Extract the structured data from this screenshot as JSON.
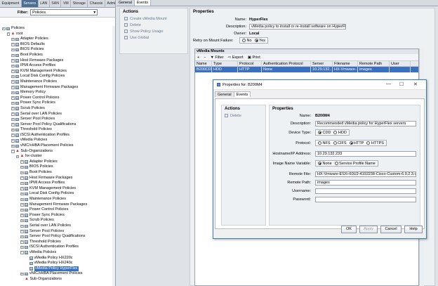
{
  "nav_tabs": [
    "Equipment",
    "Servers",
    "LAN",
    "SAN",
    "VM",
    "Storage",
    "Chassis",
    "Admin"
  ],
  "filter": {
    "label": "Filter:",
    "value": "Policies"
  },
  "tree": [
    {
      "t": "Policies",
      "d": 0,
      "ex": "-",
      "k": "folder"
    },
    {
      "t": "root",
      "d": 1,
      "ex": "-",
      "k": "org"
    },
    {
      "t": "Adapter Policies",
      "d": 2,
      "ex": "+",
      "k": "folder"
    },
    {
      "t": "BIOS Defaults",
      "d": 2,
      "ex": "+",
      "k": "folder"
    },
    {
      "t": "BIOS Policies",
      "d": 2,
      "ex": "+",
      "k": "folder"
    },
    {
      "t": "Boot Policies",
      "d": 2,
      "ex": "+",
      "k": "folder"
    },
    {
      "t": "Host Firmware Packages",
      "d": 2,
      "ex": "+",
      "k": "folder"
    },
    {
      "t": "IPMI Access Profiles",
      "d": 2,
      "ex": "+",
      "k": "folder"
    },
    {
      "t": "KVM Management Policies",
      "d": 2,
      "ex": "+",
      "k": "folder"
    },
    {
      "t": "Local Disk Config Policies",
      "d": 2,
      "ex": "+",
      "k": "folder"
    },
    {
      "t": "Maintenance Policies",
      "d": 2,
      "ex": "+",
      "k": "folder"
    },
    {
      "t": "Management Firmware Packages",
      "d": 2,
      "ex": "+",
      "k": "folder"
    },
    {
      "t": "Memory Policy",
      "d": 2,
      "ex": "+",
      "k": "folder"
    },
    {
      "t": "Power Control Policies",
      "d": 2,
      "ex": "+",
      "k": "folder"
    },
    {
      "t": "Power Sync Policies",
      "d": 2,
      "ex": "+",
      "k": "folder"
    },
    {
      "t": "Scrub Policies",
      "d": 2,
      "ex": "+",
      "k": "folder"
    },
    {
      "t": "Serial over LAN Policies",
      "d": 2,
      "ex": "+",
      "k": "folder"
    },
    {
      "t": "Server Pool Policies",
      "d": 2,
      "ex": "+",
      "k": "folder"
    },
    {
      "t": "Server Pool Policy Qualifications",
      "d": 2,
      "ex": "+",
      "k": "folder"
    },
    {
      "t": "Threshold Policies",
      "d": 2,
      "ex": "+",
      "k": "folder"
    },
    {
      "t": "iSCSI Authentication Profiles",
      "d": 2,
      "ex": "+",
      "k": "folder"
    },
    {
      "t": "vMedia Policies",
      "d": 2,
      "ex": "+",
      "k": "folder"
    },
    {
      "t": "vNIC/vHBA Placement Policies",
      "d": 2,
      "ex": "+",
      "k": "folder"
    },
    {
      "t": "Sub-Organizations",
      "d": 2,
      "ex": "-",
      "k": "org"
    },
    {
      "t": "hx-cluster",
      "d": 3,
      "ex": "-",
      "k": "org"
    },
    {
      "t": "Adapter Policies",
      "d": 4,
      "ex": "+",
      "k": "folder"
    },
    {
      "t": "BIOS Policies",
      "d": 4,
      "ex": "+",
      "k": "folder"
    },
    {
      "t": "Boot Policies",
      "d": 4,
      "ex": "+",
      "k": "folder"
    },
    {
      "t": "Host Firmware Packages",
      "d": 4,
      "ex": "+",
      "k": "folder"
    },
    {
      "t": "IPMI Access Profiles",
      "d": 4,
      "ex": "+",
      "k": "folder"
    },
    {
      "t": "KVM Management Policies",
      "d": 4,
      "ex": "+",
      "k": "folder"
    },
    {
      "t": "Local Disk Config Policies",
      "d": 4,
      "ex": "+",
      "k": "folder"
    },
    {
      "t": "Maintenance Policies",
      "d": 4,
      "ex": "+",
      "k": "folder"
    },
    {
      "t": "Management Firmware Packages",
      "d": 4,
      "ex": "+",
      "k": "folder"
    },
    {
      "t": "Power Control Policies",
      "d": 4,
      "ex": "+",
      "k": "folder"
    },
    {
      "t": "Power Sync Policies",
      "d": 4,
      "ex": "+",
      "k": "folder"
    },
    {
      "t": "Scrub Policies",
      "d": 4,
      "ex": "+",
      "k": "folder"
    },
    {
      "t": "Serial over LAN Policies",
      "d": 4,
      "ex": "+",
      "k": "folder"
    },
    {
      "t": "Server Pool Policies",
      "d": 4,
      "ex": "+",
      "k": "folder"
    },
    {
      "t": "Server Pool Policy Qualifications",
      "d": 4,
      "ex": "+",
      "k": "folder"
    },
    {
      "t": "Threshold Policies",
      "d": 4,
      "ex": "+",
      "k": "folder"
    },
    {
      "t": "iSCSI Authentication Profiles",
      "d": 4,
      "ex": "+",
      "k": "folder"
    },
    {
      "t": "vMedia Policies",
      "d": 4,
      "ex": "-",
      "k": "folder"
    },
    {
      "t": "vMedia Policy HX220c",
      "d": 5,
      "ex": "",
      "k": "item"
    },
    {
      "t": "vMedia Policy HX240c",
      "d": 5,
      "ex": "",
      "k": "item"
    },
    {
      "t": "vMedia Policy HyperFlex",
      "d": 5,
      "ex": "",
      "k": "item",
      "selected": true
    },
    {
      "t": "vNIC/vHBA Placement Policies",
      "d": 4,
      "ex": "+",
      "k": "folder"
    },
    {
      "t": "Sub-Organizations",
      "d": 4,
      "ex": "",
      "k": "org"
    }
  ],
  "right_tabs": [
    "General",
    "Events"
  ],
  "actions": {
    "title": "Actions",
    "items": [
      "Create vMedia Mount",
      "Delete",
      "Show Policy Usage",
      "Use Global"
    ]
  },
  "properties": {
    "title": "Properties",
    "name_label": "Name:",
    "name": "HyperFlex",
    "desc_label": "Description:",
    "desc": "vMedia policy to install or re-install software on HyperFlex servers",
    "owner_label": "Owner:",
    "owner": "Local",
    "retry_label": "Retry on Mount Failure:",
    "retry_no": "No",
    "retry_yes": "Yes"
  },
  "mounts": {
    "title": "vMedia Mounts",
    "tools": [
      "Filter",
      "Export",
      "Print"
    ],
    "columns": [
      "Name",
      "Type",
      "Protocol",
      "Authentication Protocol",
      "Server",
      "Filename",
      "Remote Path",
      "User"
    ],
    "row": [
      "B200CDD",
      "HDD",
      "HTTP",
      "None",
      "10.29.132...",
      "HX-Vmware-...",
      "images",
      ""
    ]
  },
  "dialog": {
    "title": "Properties for: B200M4",
    "tabs": [
      "General",
      "Events"
    ],
    "actions_title": "Actions",
    "delete": "Delete",
    "props_title": "Properties",
    "name_label": "Name:",
    "name": "B200M4",
    "desc_label": "Description:",
    "desc": "Recommended vMedia policy for HyperFlex servers",
    "devtype_label": "Device Type:",
    "dev_cdd": "CDD",
    "dev_hdd": "HDD",
    "protocol_label": "Protocol:",
    "protocols": [
      "NFS",
      "CIFS",
      "HTTP",
      "HTTPS"
    ],
    "host_label": "Hostname/IP Address:",
    "host": "10.29.132.233",
    "imgvar_label": "Image Name Variable:",
    "imgvar_none": "None",
    "imgvar_spn": "Service Profile Name",
    "remote_file_label": "Remote File:",
    "remote_file": "HX-Vmware-ESXi-60U2-4192238-Cisco-Custom-6.0.2.3.iso",
    "remote_path_label": "Remote Path:",
    "remote_path": "images",
    "username_label": "Username:",
    "username": "",
    "password_label": "Password:",
    "password": "",
    "buttons": {
      "ok": "OK",
      "cancel": "Cancel",
      "apply": "Apply",
      "help": "Help"
    }
  }
}
